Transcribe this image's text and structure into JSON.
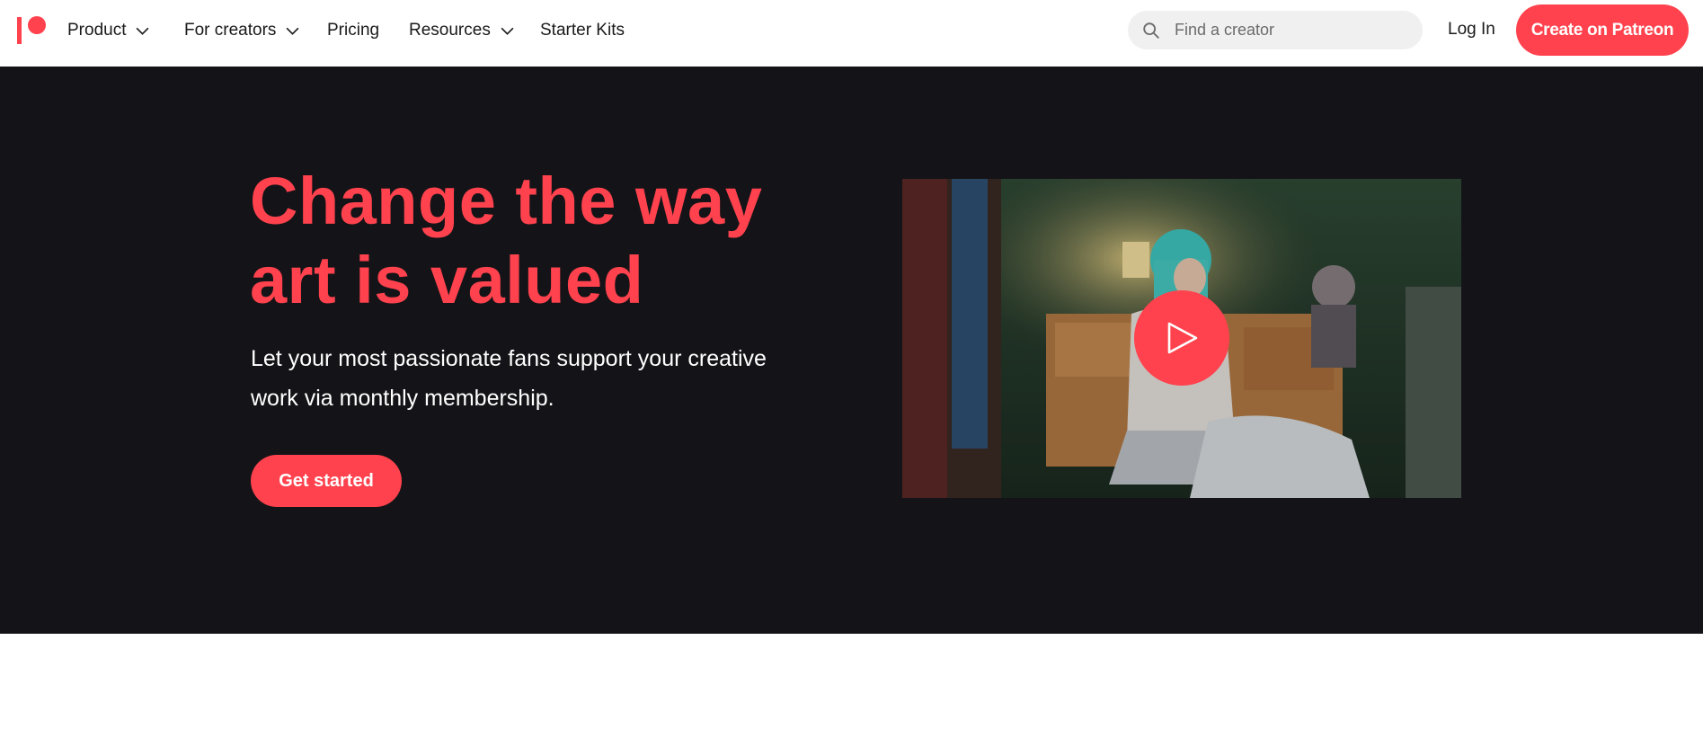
{
  "nav": {
    "logo_icon": "patreon-logo-icon",
    "items": [
      {
        "label": "Product",
        "has_dropdown": true
      },
      {
        "label": "For creators",
        "has_dropdown": true
      },
      {
        "label": "Pricing",
        "has_dropdown": false
      },
      {
        "label": "Resources",
        "has_dropdown": true
      },
      {
        "label": "Starter Kits",
        "has_dropdown": false
      }
    ],
    "search": {
      "placeholder": "Find a creator",
      "icon": "search-icon"
    },
    "login_label": "Log In",
    "create_label": "Create on Patreon"
  },
  "hero": {
    "headline": "Change the way art is valued",
    "subheadline": "Let your most passionate fans support your creative work via monthly membership.",
    "cta_label": "Get started",
    "video": {
      "icon": "play-icon"
    }
  },
  "colors": {
    "brand": "#ff424d",
    "hero_background": "#141418",
    "nav_background": "#ffffff",
    "search_background": "#f0f0f0"
  }
}
